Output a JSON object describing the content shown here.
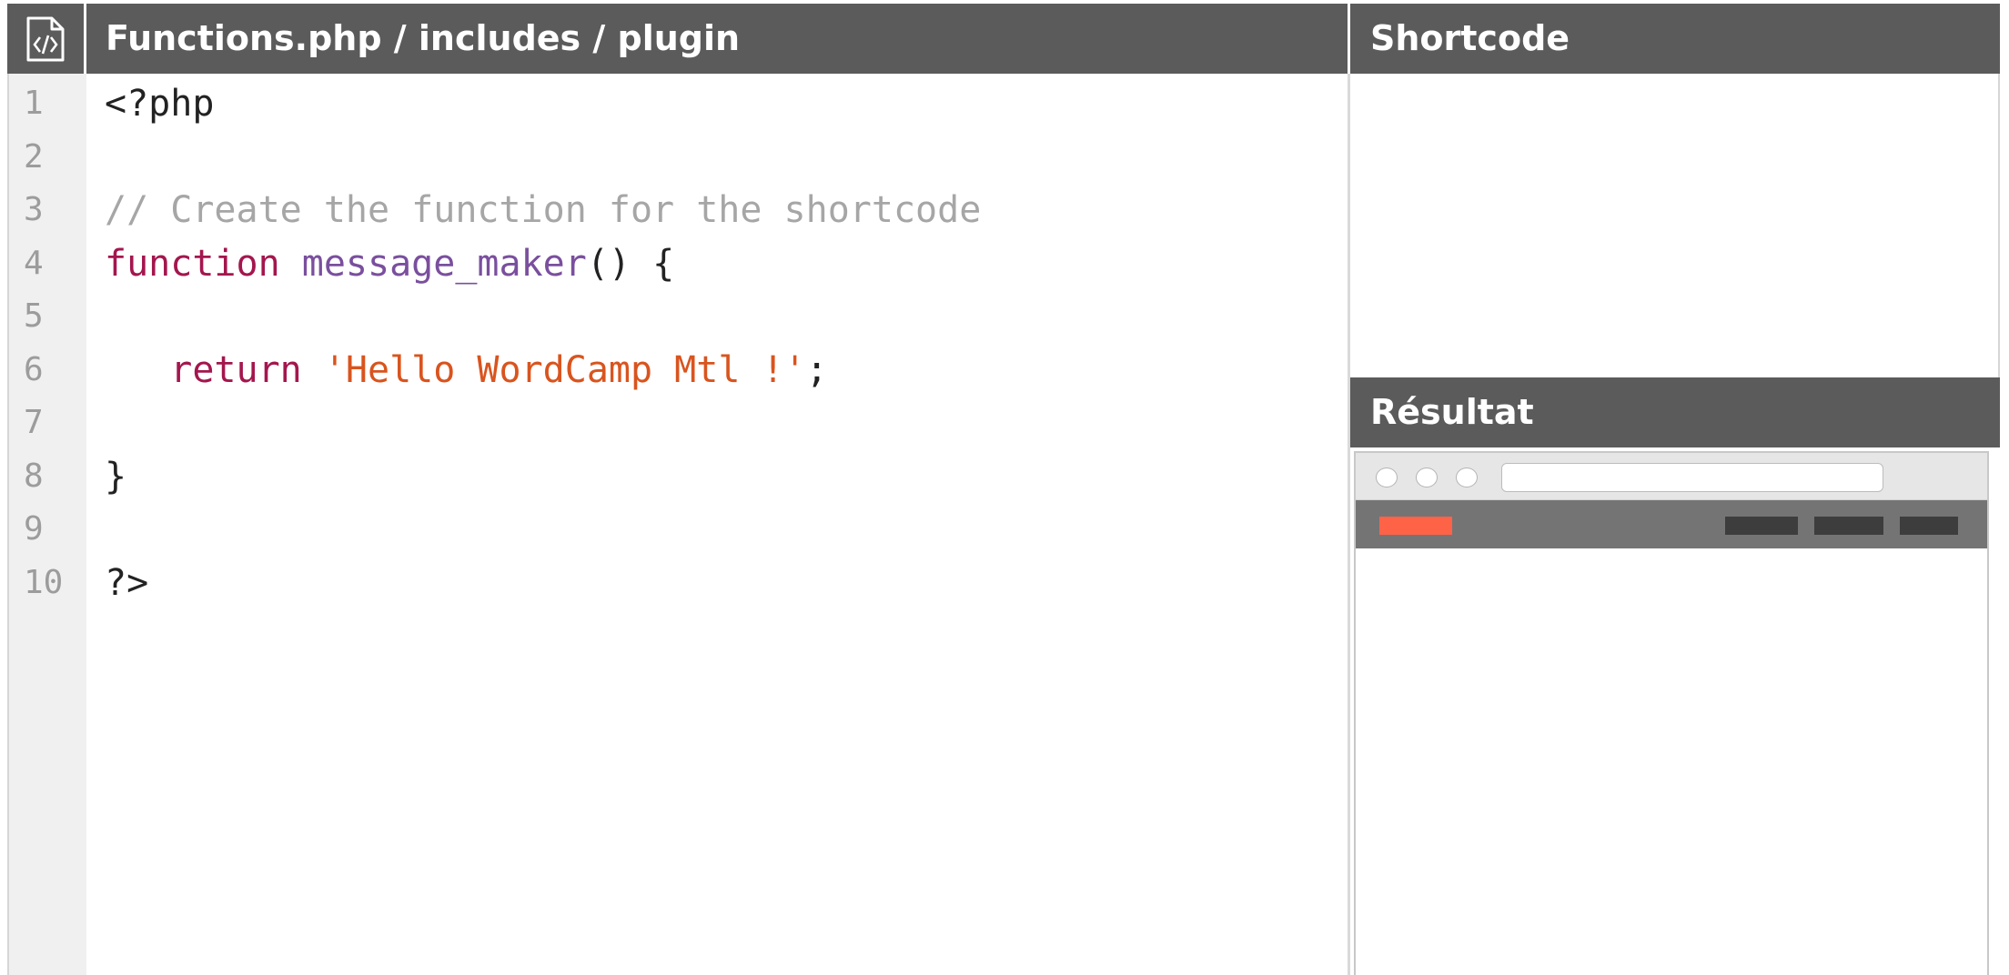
{
  "code_panel": {
    "title": "Functions.php / includes / plugin",
    "icon": "code-file-icon",
    "lines": [
      {
        "number": "1",
        "tokens": [
          {
            "type": "plain",
            "text": "<?php"
          }
        ]
      },
      {
        "number": "2",
        "tokens": []
      },
      {
        "number": "3",
        "tokens": [
          {
            "type": "comment",
            "text": "// Create the function for the shortcode"
          }
        ]
      },
      {
        "number": "4",
        "tokens": [
          {
            "type": "keyword",
            "text": "function"
          },
          {
            "type": "plain",
            "text": " "
          },
          {
            "type": "func",
            "text": "message_maker"
          },
          {
            "type": "plain",
            "text": "() {"
          }
        ]
      },
      {
        "number": "5",
        "tokens": []
      },
      {
        "number": "6",
        "tokens": [
          {
            "type": "plain",
            "text": "   "
          },
          {
            "type": "keyword",
            "text": "return"
          },
          {
            "type": "plain",
            "text": " "
          },
          {
            "type": "string",
            "text": "'Hello WordCamp Mtl !'"
          },
          {
            "type": "plain",
            "text": ";"
          }
        ]
      },
      {
        "number": "7",
        "tokens": []
      },
      {
        "number": "8",
        "tokens": [
          {
            "type": "plain",
            "text": "}"
          }
        ]
      },
      {
        "number": "9",
        "tokens": []
      },
      {
        "number": "10",
        "tokens": [
          {
            "type": "plain",
            "text": "?>"
          }
        ]
      }
    ]
  },
  "shortcode_panel": {
    "title": "Shortcode"
  },
  "result_panel": {
    "title": "Résultat",
    "browser_mockup": {
      "url_value": "",
      "nav_item_count": 3
    }
  },
  "colors": {
    "header_bg": "#5b5b5b",
    "comment": "#a6a6a6",
    "keyword": "#a4164e",
    "function_name": "#7a4f9e",
    "string": "#d9541e",
    "logo": "#ff6347",
    "nav_bg": "#747474",
    "nav_item": "#3d3d3d"
  }
}
